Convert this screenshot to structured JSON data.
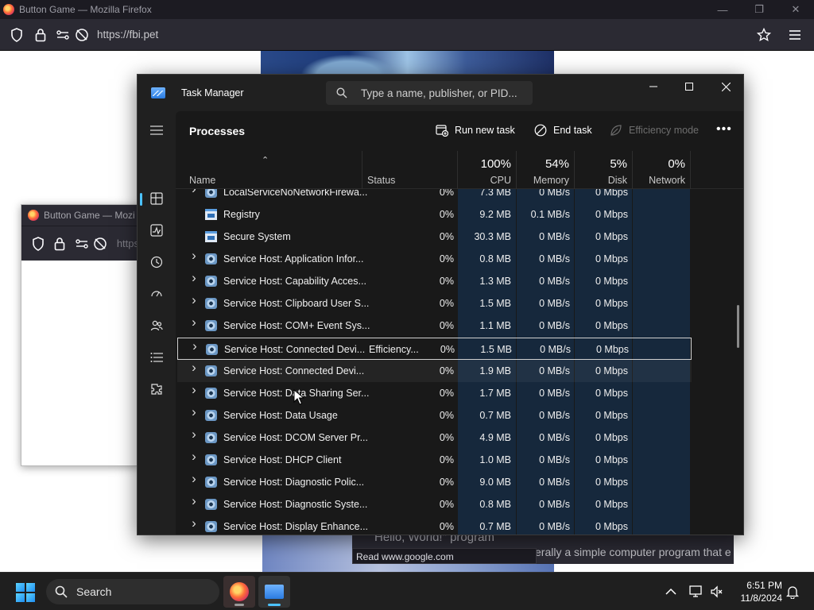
{
  "firefox": {
    "window_title": "Button Game — Mozilla Firefox",
    "url": "https://fbi.pet",
    "status_link": "Read www.google.com",
    "page_text_1": "Hello, World!\" program",
    "page_text_2": "erally a simple computer program that e"
  },
  "firefox_secondary": {
    "window_title": "Button Game — Mozi",
    "url": "https"
  },
  "task_manager": {
    "app_title": "Task Manager",
    "search_placeholder": "Type a name, publisher, or PID...",
    "page_title": "Processes",
    "toolbar": {
      "run_new_task": "Run new task",
      "end_task": "End task",
      "efficiency_mode": "Efficiency mode"
    },
    "columns": {
      "name": "Name",
      "status": "Status",
      "cpu": {
        "percent": "100%",
        "label": "CPU"
      },
      "memory": {
        "percent": "54%",
        "label": "Memory"
      },
      "disk": {
        "percent": "5%",
        "label": "Disk"
      },
      "network": {
        "percent": "0%",
        "label": "Network"
      }
    },
    "processes": [
      {
        "name": "LocalServiceNoNetworkFirewa...",
        "status": "",
        "cpu": "0%",
        "memory": "7.3 MB",
        "disk": "0 MB/s",
        "network": "0 Mbps",
        "expandable": true,
        "icon": "service-gear-icon"
      },
      {
        "name": "Registry",
        "status": "",
        "cpu": "0%",
        "memory": "9.2 MB",
        "disk": "0.1 MB/s",
        "network": "0 Mbps",
        "expandable": false,
        "icon": "system-window-icon"
      },
      {
        "name": "Secure System",
        "status": "",
        "cpu": "0%",
        "memory": "30.3 MB",
        "disk": "0 MB/s",
        "network": "0 Mbps",
        "expandable": false,
        "icon": "system-window-icon"
      },
      {
        "name": "Service Host: Application Infor...",
        "status": "",
        "cpu": "0%",
        "memory": "0.8 MB",
        "disk": "0 MB/s",
        "network": "0 Mbps",
        "expandable": true,
        "icon": "service-gear-icon"
      },
      {
        "name": "Service Host: Capability Acces...",
        "status": "",
        "cpu": "0%",
        "memory": "1.3 MB",
        "disk": "0 MB/s",
        "network": "0 Mbps",
        "expandable": true,
        "icon": "service-gear-icon"
      },
      {
        "name": "Service Host: Clipboard User S...",
        "status": "",
        "cpu": "0%",
        "memory": "1.5 MB",
        "disk": "0 MB/s",
        "network": "0 Mbps",
        "expandable": true,
        "icon": "service-gear-icon"
      },
      {
        "name": "Service Host: COM+ Event Sys...",
        "status": "",
        "cpu": "0%",
        "memory": "1.1 MB",
        "disk": "0 MB/s",
        "network": "0 Mbps",
        "expandable": true,
        "icon": "service-gear-icon"
      },
      {
        "name": "Service Host: Connected Devi...",
        "status": "Efficiency...",
        "cpu": "0%",
        "memory": "1.5 MB",
        "disk": "0 MB/s",
        "network": "0 Mbps",
        "expandable": true,
        "icon": "service-gear-icon",
        "selected": true
      },
      {
        "name": "Service Host: Connected Devi...",
        "status": "",
        "cpu": "0%",
        "memory": "1.9 MB",
        "disk": "0 MB/s",
        "network": "0 Mbps",
        "expandable": true,
        "icon": "service-gear-icon",
        "hover": true
      },
      {
        "name": "Service Host: Data Sharing Ser...",
        "status": "",
        "cpu": "0%",
        "memory": "1.7 MB",
        "disk": "0 MB/s",
        "network": "0 Mbps",
        "expandable": true,
        "icon": "service-gear-icon"
      },
      {
        "name": "Service Host: Data Usage",
        "status": "",
        "cpu": "0%",
        "memory": "0.7 MB",
        "disk": "0 MB/s",
        "network": "0 Mbps",
        "expandable": true,
        "icon": "service-gear-icon"
      },
      {
        "name": "Service Host: DCOM Server Pr...",
        "status": "",
        "cpu": "0%",
        "memory": "4.9 MB",
        "disk": "0 MB/s",
        "network": "0 Mbps",
        "expandable": true,
        "icon": "service-gear-icon"
      },
      {
        "name": "Service Host: DHCP Client",
        "status": "",
        "cpu": "0%",
        "memory": "1.0 MB",
        "disk": "0 MB/s",
        "network": "0 Mbps",
        "expandable": true,
        "icon": "service-gear-icon"
      },
      {
        "name": "Service Host: Diagnostic Polic...",
        "status": "",
        "cpu": "0%",
        "memory": "9.0 MB",
        "disk": "0 MB/s",
        "network": "0 Mbps",
        "expandable": true,
        "icon": "service-gear-icon"
      },
      {
        "name": "Service Host: Diagnostic Syste...",
        "status": "",
        "cpu": "0%",
        "memory": "0.8 MB",
        "disk": "0 MB/s",
        "network": "0 Mbps",
        "expandable": true,
        "icon": "service-gear-icon"
      },
      {
        "name": "Service Host: Display Enhance...",
        "status": "",
        "cpu": "0%",
        "memory": "0.7 MB",
        "disk": "0 MB/s",
        "network": "0 Mbps",
        "expandable": true,
        "icon": "service-gear-icon"
      }
    ],
    "sidebar_icons": [
      "hamburger-menu-icon",
      "processes-icon",
      "performance-icon",
      "app-history-icon",
      "startup-apps-icon",
      "users-icon",
      "details-icon",
      "services-icon",
      "settings-icon"
    ]
  },
  "taskbar": {
    "search_placeholder": "Search",
    "time": "6:51 PM",
    "date": "11/8/2024"
  },
  "colors": {
    "accent": "#4cc2ff",
    "tm_background": "#202020",
    "tm_content": "#191919",
    "highlight_column": "#16283c",
    "firefox_chrome": "#2b2a33"
  }
}
